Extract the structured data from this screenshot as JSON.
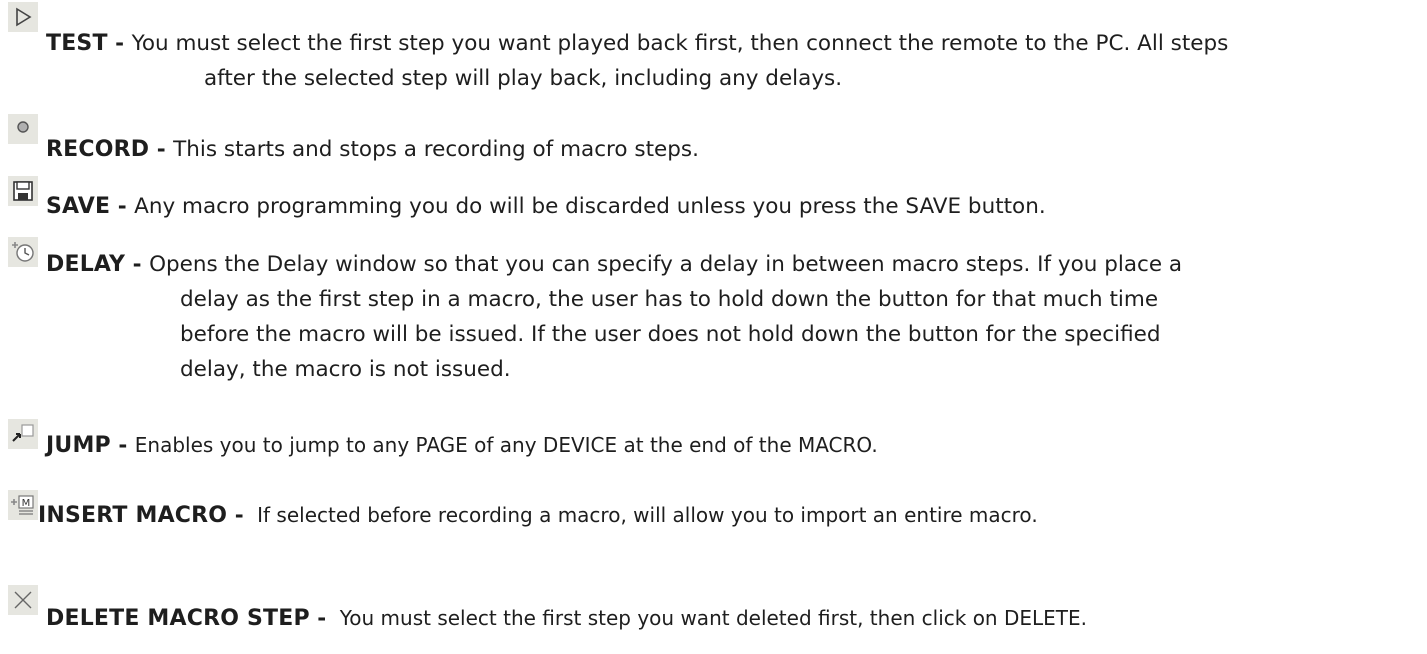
{
  "items": [
    {
      "icon": "play-outline-icon",
      "term": "TEST",
      "sep": " - ",
      "lines": [
        "You must select the first step you want played back first, then connect the remote to the PC. All steps",
        "after the selected step will play back, including any delays."
      ]
    },
    {
      "icon": "record-icon",
      "term": "RECORD",
      "sep": " - ",
      "lines": [
        "This starts and stops a recording of macro steps."
      ]
    },
    {
      "icon": "floppy-disk-icon",
      "term": "SAVE",
      "sep": " - ",
      "lines": [
        "Any macro programming you do will be discarded unless you press the SAVE button."
      ]
    },
    {
      "icon": "clock-plus-icon",
      "term": "DELAY",
      "sep": " - ",
      "lines": [
        "Opens the Delay window so that you can specify a delay in between macro steps. If you place a",
        "delay as the first step in a macro, the user has to hold down the button for that much time",
        "before the macro will be issued. If the user does not hold down the button for the specified",
        "delay, the macro is not issued."
      ]
    },
    {
      "icon": "jump-page-icon",
      "term": "JUMP",
      "sep": " - ",
      "lines": [
        "Enables you to jump to any PAGE of any DEVICE at the end of the MACRO."
      ]
    },
    {
      "icon": "insert-macro-icon",
      "term": "INSERT MACRO",
      "sep": " - ",
      "lines": [
        "If selected before recording a macro, will allow you to import an entire macro."
      ]
    },
    {
      "icon": "delete-x-icon",
      "term": "DELETE MACRO STEP",
      "sep": " - ",
      "lines": [
        "You must select the first step you want deleted first, then click on  DELETE."
      ]
    }
  ]
}
